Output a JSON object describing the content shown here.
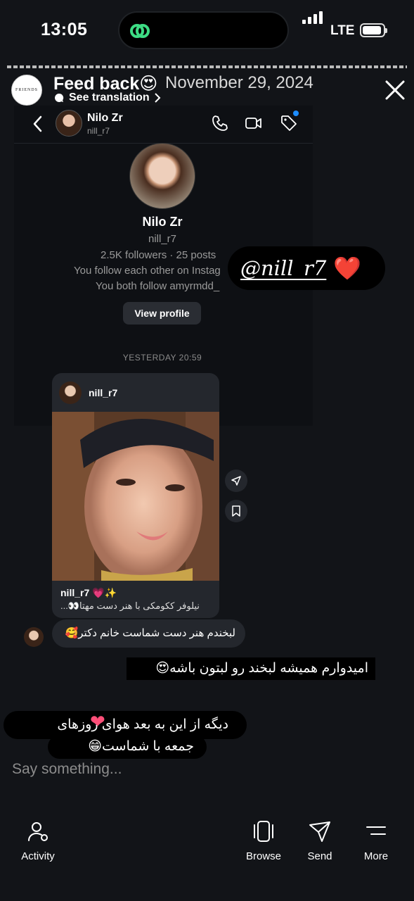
{
  "status_bar": {
    "time": "13:05",
    "network": "LTE"
  },
  "story_header": {
    "title": "Feed back😍",
    "date": "November 29, 2024",
    "see_translation": "See translation",
    "avatar_text": "FRIENDS"
  },
  "dm_header": {
    "name": "Nilo Zr",
    "handle": "nill_r7"
  },
  "profile": {
    "name": "Nilo Zr",
    "handle": "nill_r7",
    "stats": "2.5K followers · 25 posts",
    "follow_each_other": "You follow each other on Instag",
    "mutual": "You both follow amyrmdd_",
    "view_profile": "View profile"
  },
  "mention_sticker": {
    "text": "@nill_r7",
    "emoji": "❤️"
  },
  "thread": {
    "timestamp": "YESTERDAY 20:59"
  },
  "shared_post": {
    "user": "nill_r7",
    "caption_user": "nill_r7 💗✨",
    "caption_text": "نیلوفر ککومکی با هنر دست مهتا👀..."
  },
  "reply": {
    "text": "لبخندم هنر دست شماست خانم دکتر🥰"
  },
  "stickers": {
    "line1": "امیدوارم همیشه لبخند رو لبتون باشه😍",
    "line2": "دیگه از این به بعد هوای روزهای",
    "line3": "جمعه با شماست😁",
    "heart": "❤"
  },
  "composer": {
    "placeholder": "Say something..."
  },
  "bottom_nav": {
    "activity": "Activity",
    "browse": "Browse",
    "send": "Send",
    "more": "More"
  },
  "colors": {
    "background": "#121418",
    "bubble": "#24272d",
    "accent_blue": "#1d8cff",
    "heart_red": "#e3282c",
    "link_green": "#3ddc84"
  }
}
